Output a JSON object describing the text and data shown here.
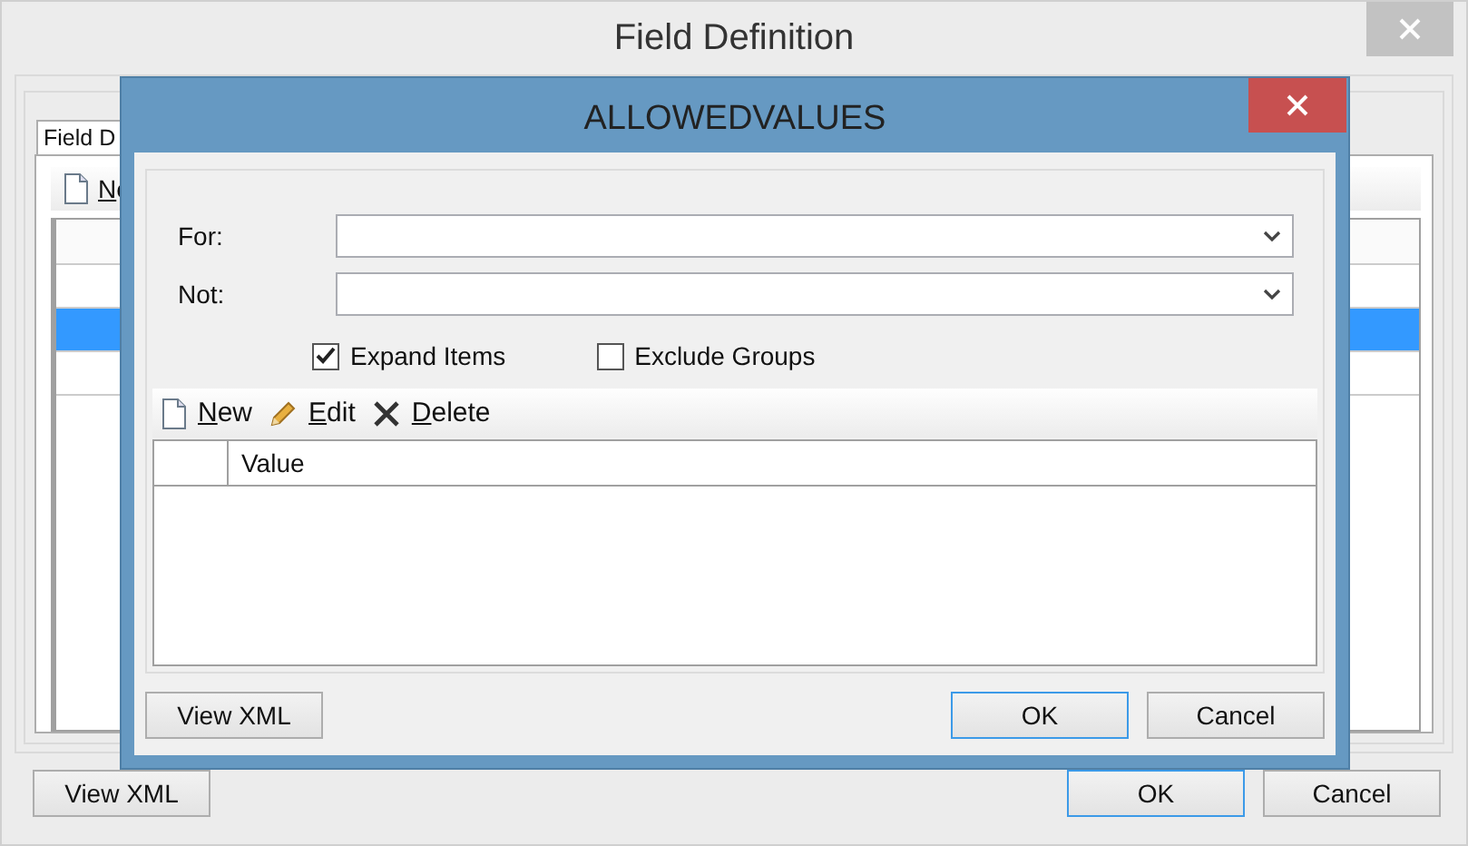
{
  "window": {
    "title": "Field Definition"
  },
  "tabs": [
    {
      "label": "Field D",
      "selected": true
    }
  ],
  "toolbar": [
    {
      "label": "Ne",
      "kind": "new",
      "mnemonic_underlined": true
    }
  ],
  "grid": {
    "rows": [
      {
        "selected": false
      },
      {
        "selected": true
      },
      {
        "selected": false
      }
    ]
  },
  "buttons": [
    {
      "label": "View XML",
      "default": false
    },
    {
      "label": "OK",
      "default": true
    },
    {
      "label": "Cancel",
      "default": false
    }
  ],
  "dialog": {
    "title": "ALLOWEDVALUES",
    "fields": [
      {
        "label": "For:"
      },
      {
        "label": "Not:"
      }
    ],
    "checkboxes": [
      {
        "label": "Expand Items",
        "checked": true
      },
      {
        "label": "Exclude Groups",
        "checked": false
      }
    ],
    "toolbar": [
      {
        "label": "New",
        "kind": "new",
        "mnemonic_underlined": true
      },
      {
        "label": "Edit",
        "kind": "edit",
        "mnemonic_underlined": true
      },
      {
        "label": "Delete",
        "kind": "delete",
        "mnemonic_underlined": true
      }
    ],
    "table": {
      "columns": [
        "Value"
      ]
    },
    "buttons": [
      {
        "label": "View XML",
        "default": false
      },
      {
        "label": "OK",
        "default": true
      },
      {
        "label": "Cancel",
        "default": false
      }
    ]
  }
}
